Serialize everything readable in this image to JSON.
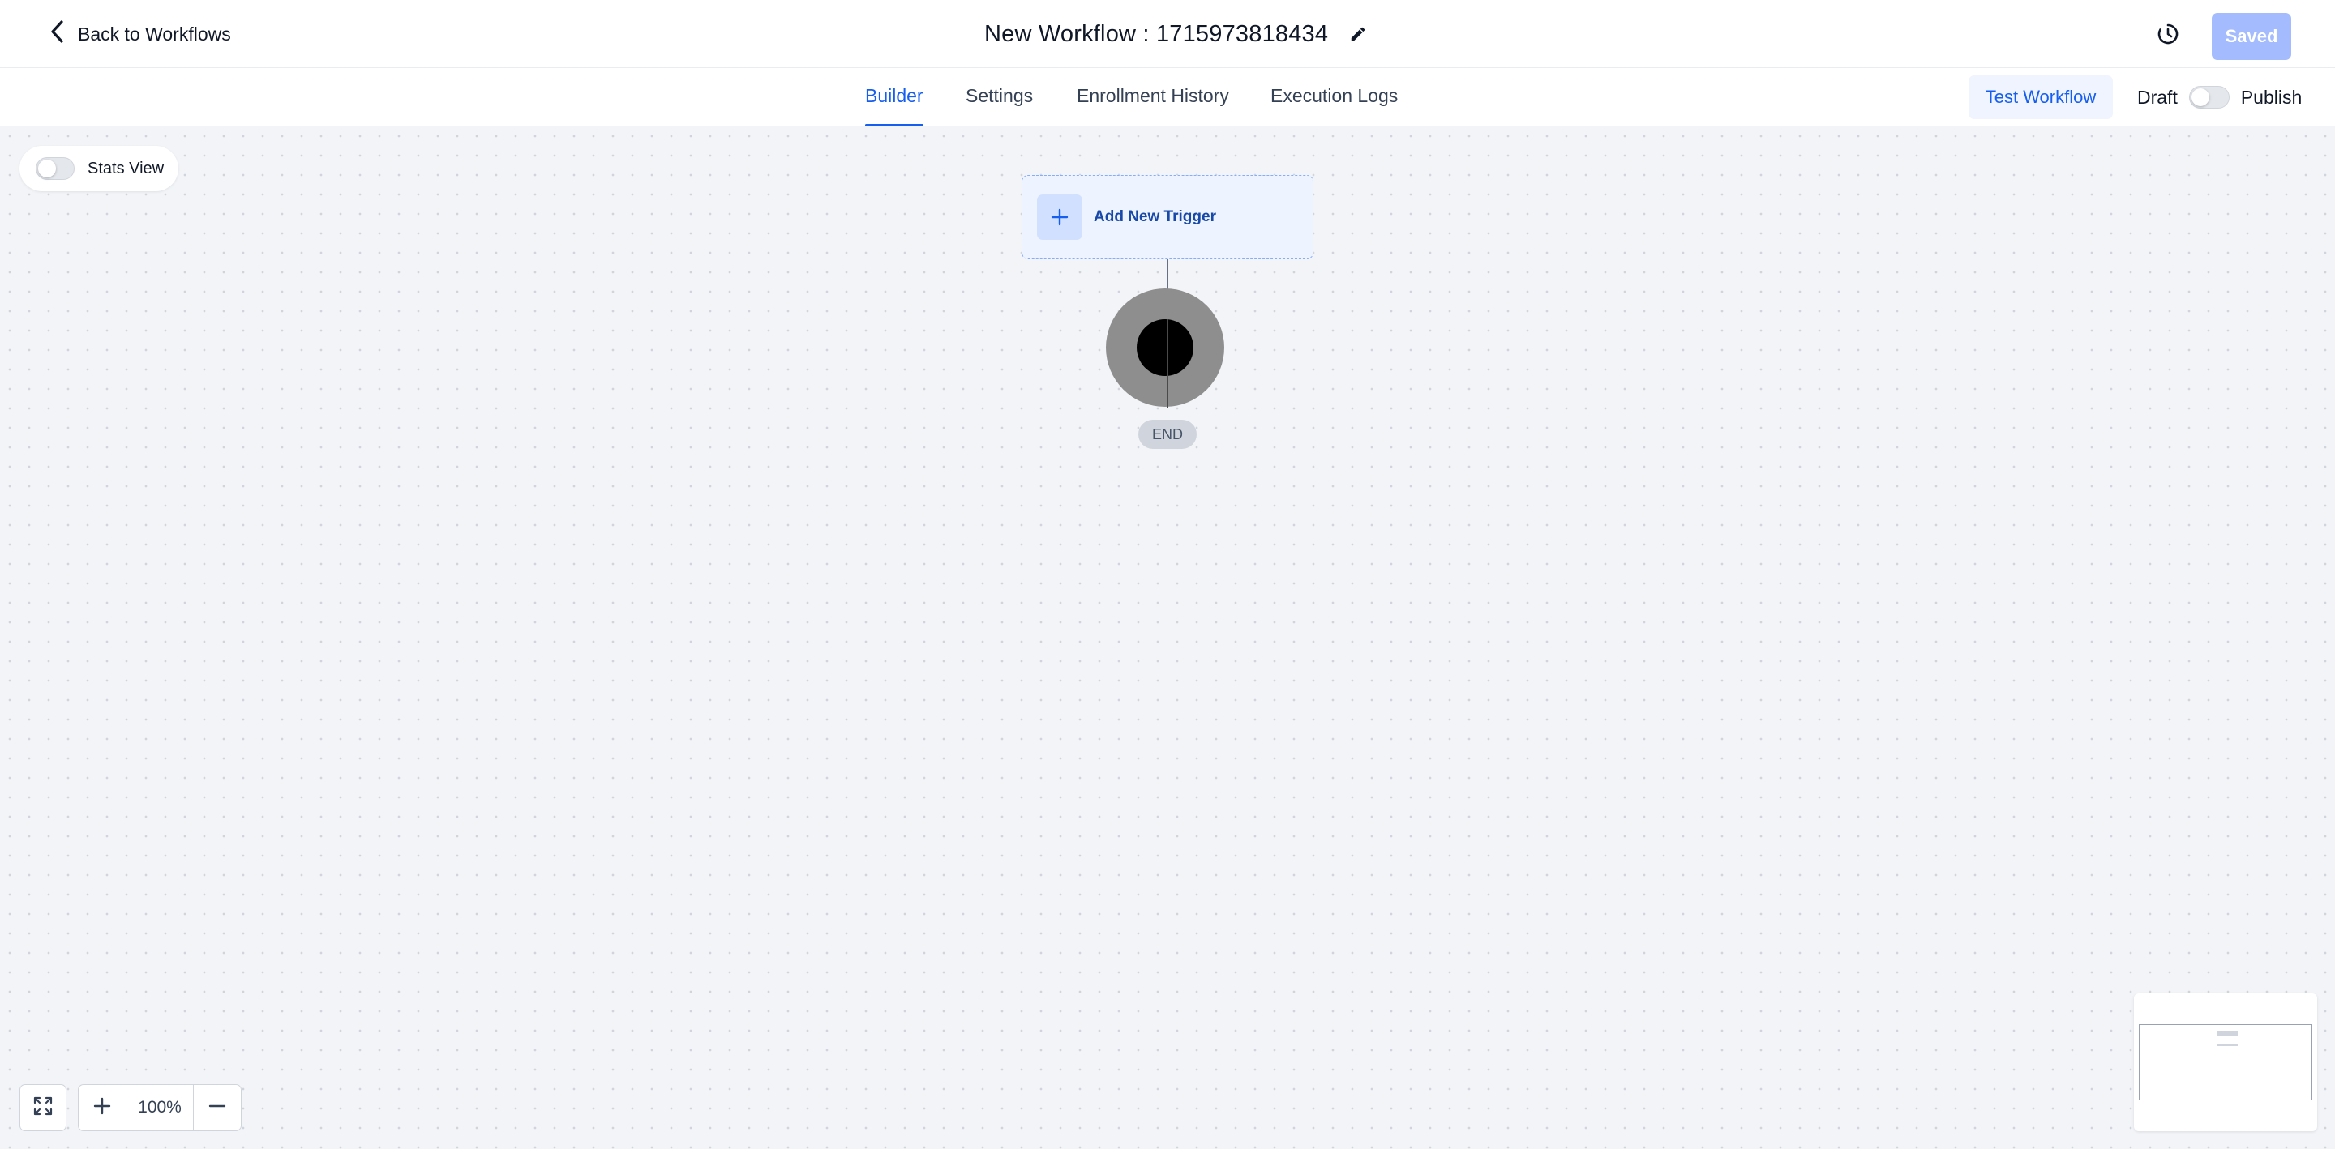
{
  "header": {
    "back_label": "Back to Workflows",
    "workflow_title": "New Workflow : 1715973818434",
    "saved_label": "Saved",
    "icons": {
      "back": "chevron-left-icon",
      "edit": "pencil-icon",
      "history": "history-icon"
    }
  },
  "tabs": [
    {
      "label": "Builder",
      "active": true
    },
    {
      "label": "Settings",
      "active": false
    },
    {
      "label": "Enrollment History",
      "active": false
    },
    {
      "label": "Execution Logs",
      "active": false
    }
  ],
  "actions": {
    "test_workflow_label": "Test Workflow",
    "draft_label": "Draft",
    "publish_label": "Publish",
    "publish_toggle_on": false
  },
  "canvas": {
    "stats_view_label": "Stats View",
    "stats_view_on": false,
    "trigger_label": "Add New Trigger",
    "end_label": "END"
  },
  "zoom": {
    "level": "100%"
  },
  "colors": {
    "accent": "#155eef",
    "saved_button_bg": "#a4bcfd",
    "canvas_bg": "#f2f4f7",
    "trigger_bg": "#eef4ff",
    "trigger_border": "#84adff"
  }
}
